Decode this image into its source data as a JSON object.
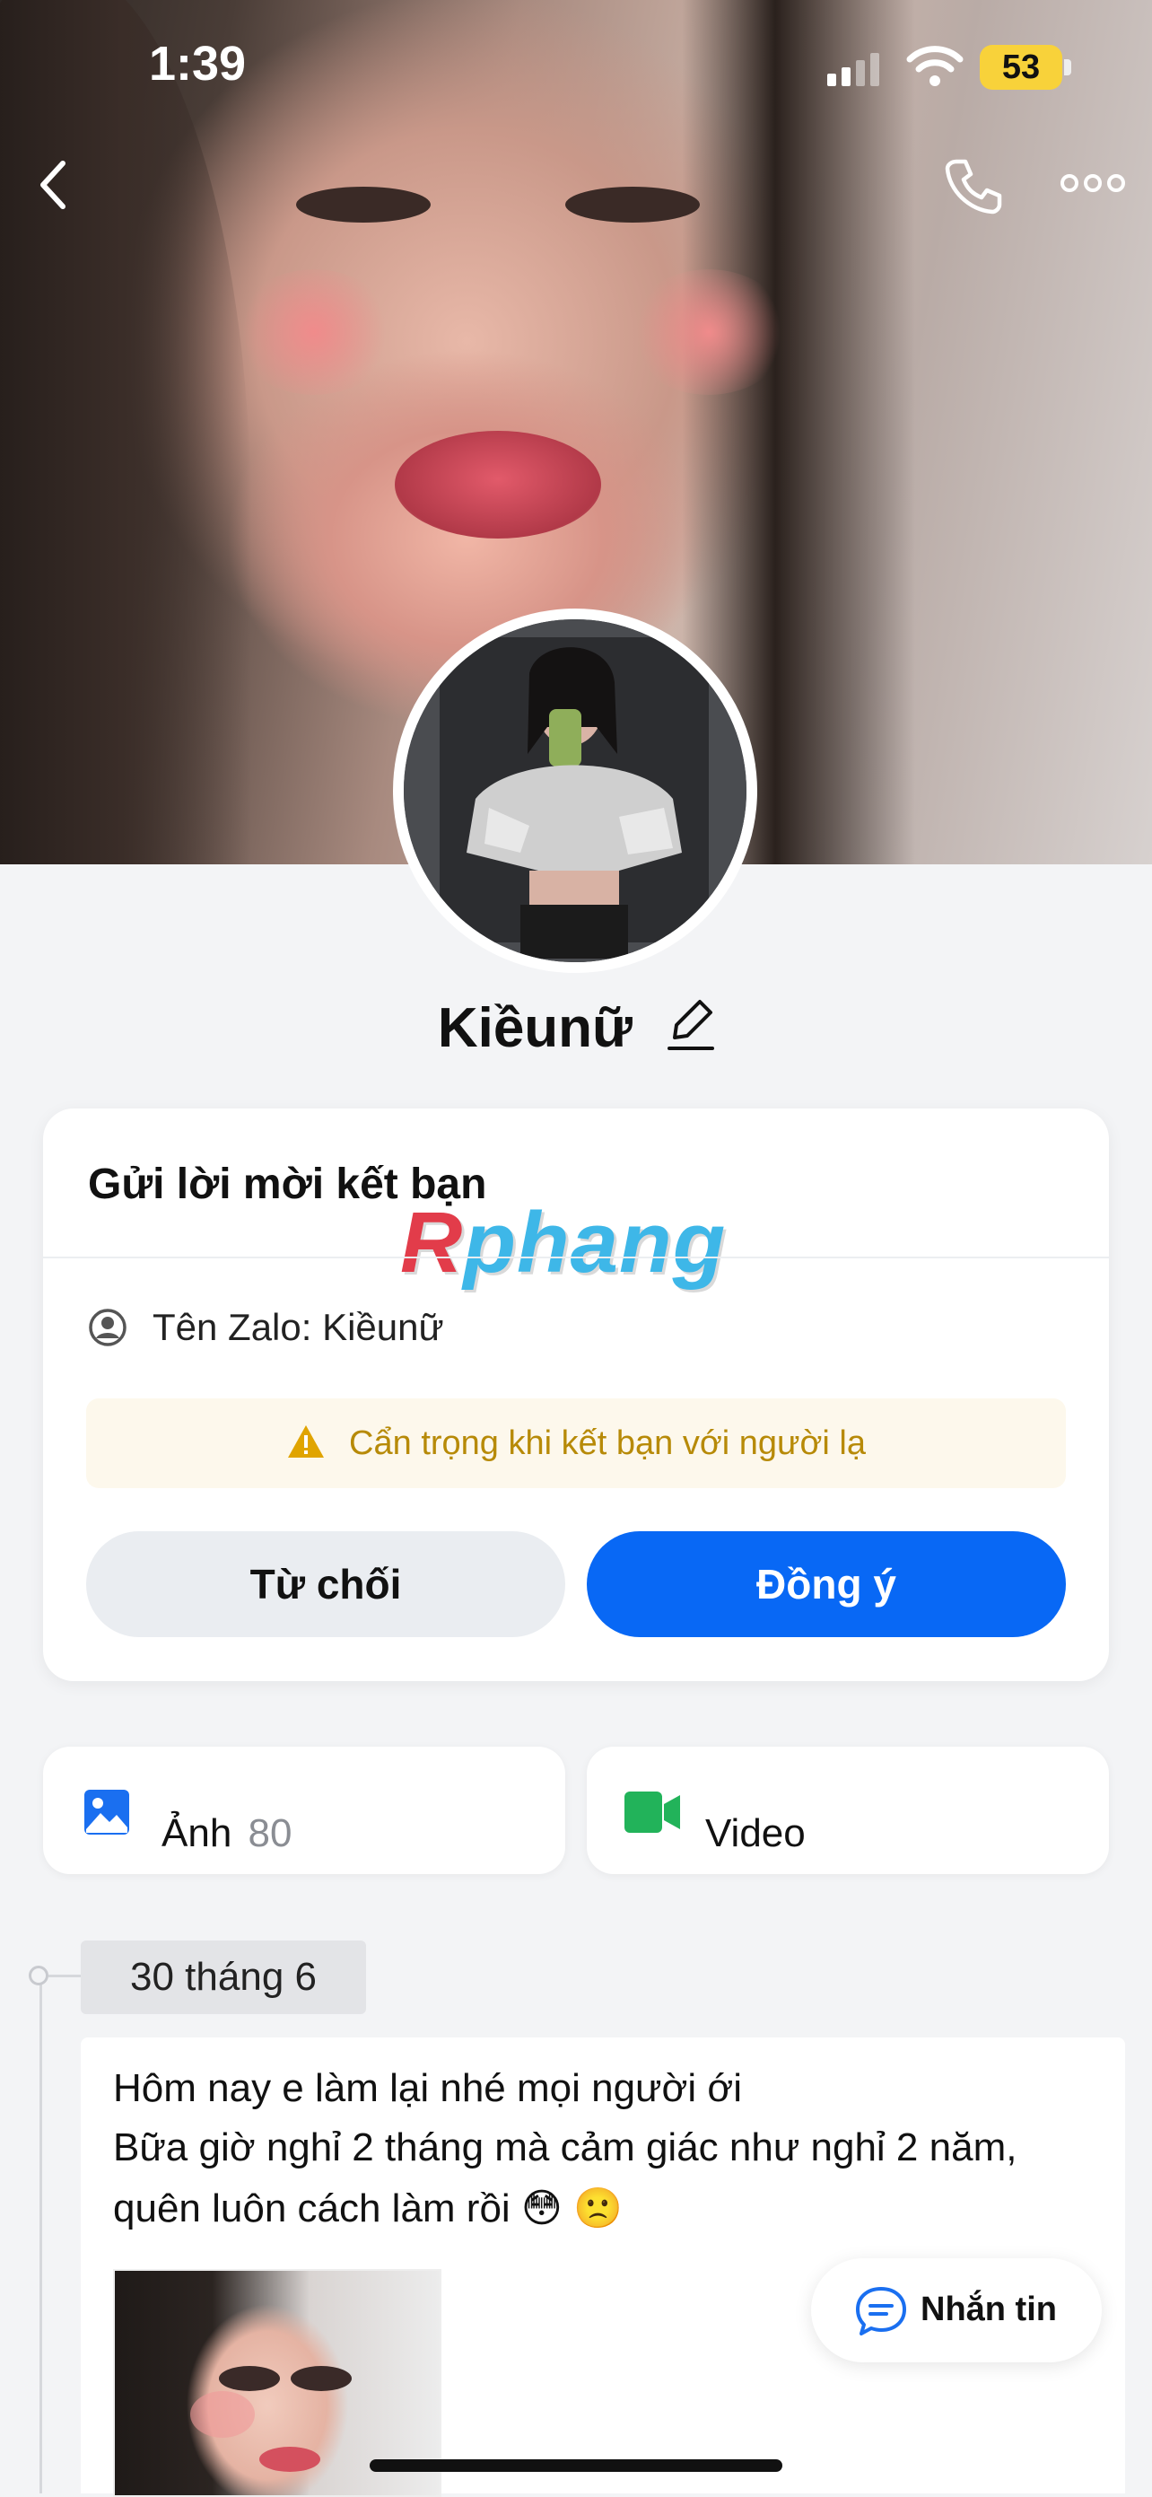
{
  "status_bar": {
    "time": "1:39",
    "battery": "53"
  },
  "profile": {
    "name": "Kiềunữ"
  },
  "friend_request": {
    "title": "Gửi lời mời kết bạn",
    "zalo_name_label": "Tên Zalo: Kiềunữ",
    "warning": "Cẩn trọng khi kết bạn với người lạ",
    "decline_label": "Từ chối",
    "accept_label": "Đồng ý"
  },
  "watermark": {
    "first": "R",
    "rest": "phang"
  },
  "media_tiles": {
    "photos_label": "Ảnh",
    "photos_count": "80",
    "video_label": "Video"
  },
  "timeline": {
    "date": "30 tháng 6",
    "post_lines": [
      "Hôm nay e làm lại nhé mọi người ới",
      "Bữa giờ nghỉ 2 tháng mà cảm giác như nghỉ 2 năm,",
      "quên luôn cách làm rồi 😳 🙁"
    ]
  },
  "message_button": {
    "label": "Nhắn tin"
  },
  "colors": {
    "accent": "#0868f5",
    "warning_text": "#b78a08",
    "video_icon": "#22b35a"
  }
}
